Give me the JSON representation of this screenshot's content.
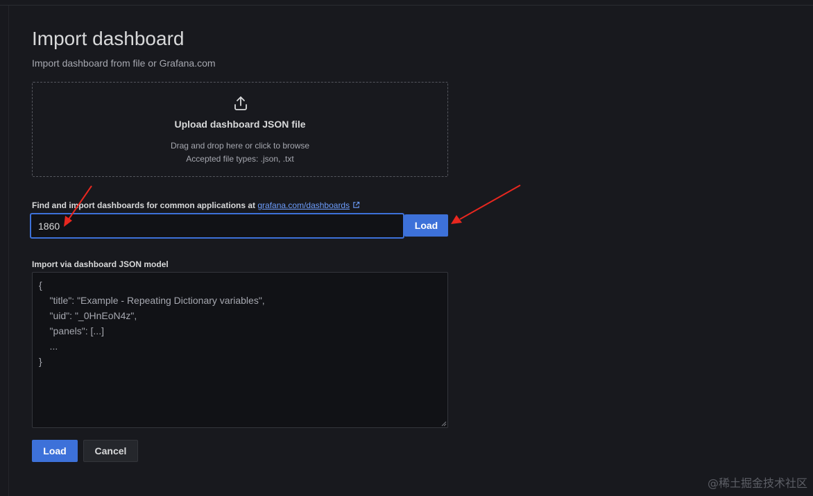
{
  "page": {
    "title": "Import dashboard",
    "subtitle": "Import dashboard from file or Grafana.com"
  },
  "upload": {
    "icon": "upload-icon",
    "title": "Upload dashboard JSON file",
    "hint_line1": "Drag and drop here or click to browse",
    "hint_line2": "Accepted file types: .json, .txt"
  },
  "grafana_com": {
    "label_prefix": "Find and import dashboards for common applications at ",
    "link_text": "grafana.com/dashboards",
    "link_icon": "external-link-icon",
    "input_value": "1860",
    "load_label": "Load"
  },
  "json_model": {
    "label": "Import via dashboard JSON model",
    "placeholder_lines": [
      "{",
      "    \"title\": \"Example - Repeating Dictionary variables\",",
      "    \"uid\": \"_0HnEoN4z\",",
      "    \"panels\": [...]",
      "    ...",
      "}"
    ]
  },
  "actions": {
    "load_label": "Load",
    "cancel_label": "Cancel"
  },
  "annotations": {
    "arrow_color": "#e8271f"
  },
  "watermark": "@稀土掘金技术社区",
  "colors": {
    "background": "#18191e",
    "primary": "#3d71d9",
    "link": "#6e9fff",
    "text": "#d8d9da",
    "secondary_text": "#a6a8b0"
  }
}
